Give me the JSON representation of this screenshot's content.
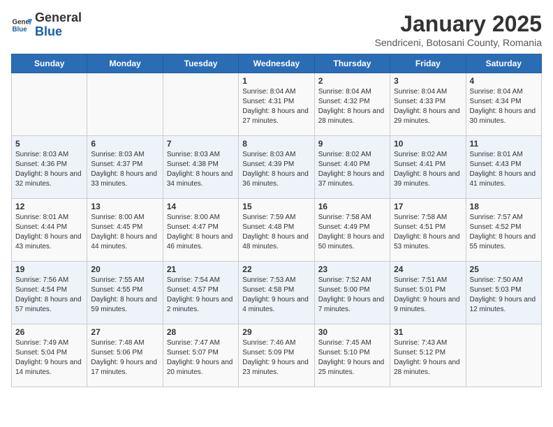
{
  "header": {
    "logo": {
      "general": "General",
      "blue": "Blue"
    },
    "title": "January 2025",
    "subtitle": "Sendriceni, Botosani County, Romania"
  },
  "weekdays": [
    "Sunday",
    "Monday",
    "Tuesday",
    "Wednesday",
    "Thursday",
    "Friday",
    "Saturday"
  ],
  "weeks": [
    [
      {
        "day": "",
        "info": ""
      },
      {
        "day": "",
        "info": ""
      },
      {
        "day": "",
        "info": ""
      },
      {
        "day": "1",
        "info": "Sunrise: 8:04 AM\nSunset: 4:31 PM\nDaylight: 8 hours and 27 minutes."
      },
      {
        "day": "2",
        "info": "Sunrise: 8:04 AM\nSunset: 4:32 PM\nDaylight: 8 hours and 28 minutes."
      },
      {
        "day": "3",
        "info": "Sunrise: 8:04 AM\nSunset: 4:33 PM\nDaylight: 8 hours and 29 minutes."
      },
      {
        "day": "4",
        "info": "Sunrise: 8:04 AM\nSunset: 4:34 PM\nDaylight: 8 hours and 30 minutes."
      }
    ],
    [
      {
        "day": "5",
        "info": "Sunrise: 8:03 AM\nSunset: 4:36 PM\nDaylight: 8 hours and 32 minutes."
      },
      {
        "day": "6",
        "info": "Sunrise: 8:03 AM\nSunset: 4:37 PM\nDaylight: 8 hours and 33 minutes."
      },
      {
        "day": "7",
        "info": "Sunrise: 8:03 AM\nSunset: 4:38 PM\nDaylight: 8 hours and 34 minutes."
      },
      {
        "day": "8",
        "info": "Sunrise: 8:03 AM\nSunset: 4:39 PM\nDaylight: 8 hours and 36 minutes."
      },
      {
        "day": "9",
        "info": "Sunrise: 8:02 AM\nSunset: 4:40 PM\nDaylight: 8 hours and 37 minutes."
      },
      {
        "day": "10",
        "info": "Sunrise: 8:02 AM\nSunset: 4:41 PM\nDaylight: 8 hours and 39 minutes."
      },
      {
        "day": "11",
        "info": "Sunrise: 8:01 AM\nSunset: 4:43 PM\nDaylight: 8 hours and 41 minutes."
      }
    ],
    [
      {
        "day": "12",
        "info": "Sunrise: 8:01 AM\nSunset: 4:44 PM\nDaylight: 8 hours and 43 minutes."
      },
      {
        "day": "13",
        "info": "Sunrise: 8:00 AM\nSunset: 4:45 PM\nDaylight: 8 hours and 44 minutes."
      },
      {
        "day": "14",
        "info": "Sunrise: 8:00 AM\nSunset: 4:47 PM\nDaylight: 8 hours and 46 minutes."
      },
      {
        "day": "15",
        "info": "Sunrise: 7:59 AM\nSunset: 4:48 PM\nDaylight: 8 hours and 48 minutes."
      },
      {
        "day": "16",
        "info": "Sunrise: 7:58 AM\nSunset: 4:49 PM\nDaylight: 8 hours and 50 minutes."
      },
      {
        "day": "17",
        "info": "Sunrise: 7:58 AM\nSunset: 4:51 PM\nDaylight: 8 hours and 53 minutes."
      },
      {
        "day": "18",
        "info": "Sunrise: 7:57 AM\nSunset: 4:52 PM\nDaylight: 8 hours and 55 minutes."
      }
    ],
    [
      {
        "day": "19",
        "info": "Sunrise: 7:56 AM\nSunset: 4:54 PM\nDaylight: 8 hours and 57 minutes."
      },
      {
        "day": "20",
        "info": "Sunrise: 7:55 AM\nSunset: 4:55 PM\nDaylight: 8 hours and 59 minutes."
      },
      {
        "day": "21",
        "info": "Sunrise: 7:54 AM\nSunset: 4:57 PM\nDaylight: 9 hours and 2 minutes."
      },
      {
        "day": "22",
        "info": "Sunrise: 7:53 AM\nSunset: 4:58 PM\nDaylight: 9 hours and 4 minutes."
      },
      {
        "day": "23",
        "info": "Sunrise: 7:52 AM\nSunset: 5:00 PM\nDaylight: 9 hours and 7 minutes."
      },
      {
        "day": "24",
        "info": "Sunrise: 7:51 AM\nSunset: 5:01 PM\nDaylight: 9 hours and 9 minutes."
      },
      {
        "day": "25",
        "info": "Sunrise: 7:50 AM\nSunset: 5:03 PM\nDaylight: 9 hours and 12 minutes."
      }
    ],
    [
      {
        "day": "26",
        "info": "Sunrise: 7:49 AM\nSunset: 5:04 PM\nDaylight: 9 hours and 14 minutes."
      },
      {
        "day": "27",
        "info": "Sunrise: 7:48 AM\nSunset: 5:06 PM\nDaylight: 9 hours and 17 minutes."
      },
      {
        "day": "28",
        "info": "Sunrise: 7:47 AM\nSunset: 5:07 PM\nDaylight: 9 hours and 20 minutes."
      },
      {
        "day": "29",
        "info": "Sunrise: 7:46 AM\nSunset: 5:09 PM\nDaylight: 9 hours and 23 minutes."
      },
      {
        "day": "30",
        "info": "Sunrise: 7:45 AM\nSunset: 5:10 PM\nDaylight: 9 hours and 25 minutes."
      },
      {
        "day": "31",
        "info": "Sunrise: 7:43 AM\nSunset: 5:12 PM\nDaylight: 9 hours and 28 minutes."
      },
      {
        "day": "",
        "info": ""
      }
    ]
  ]
}
